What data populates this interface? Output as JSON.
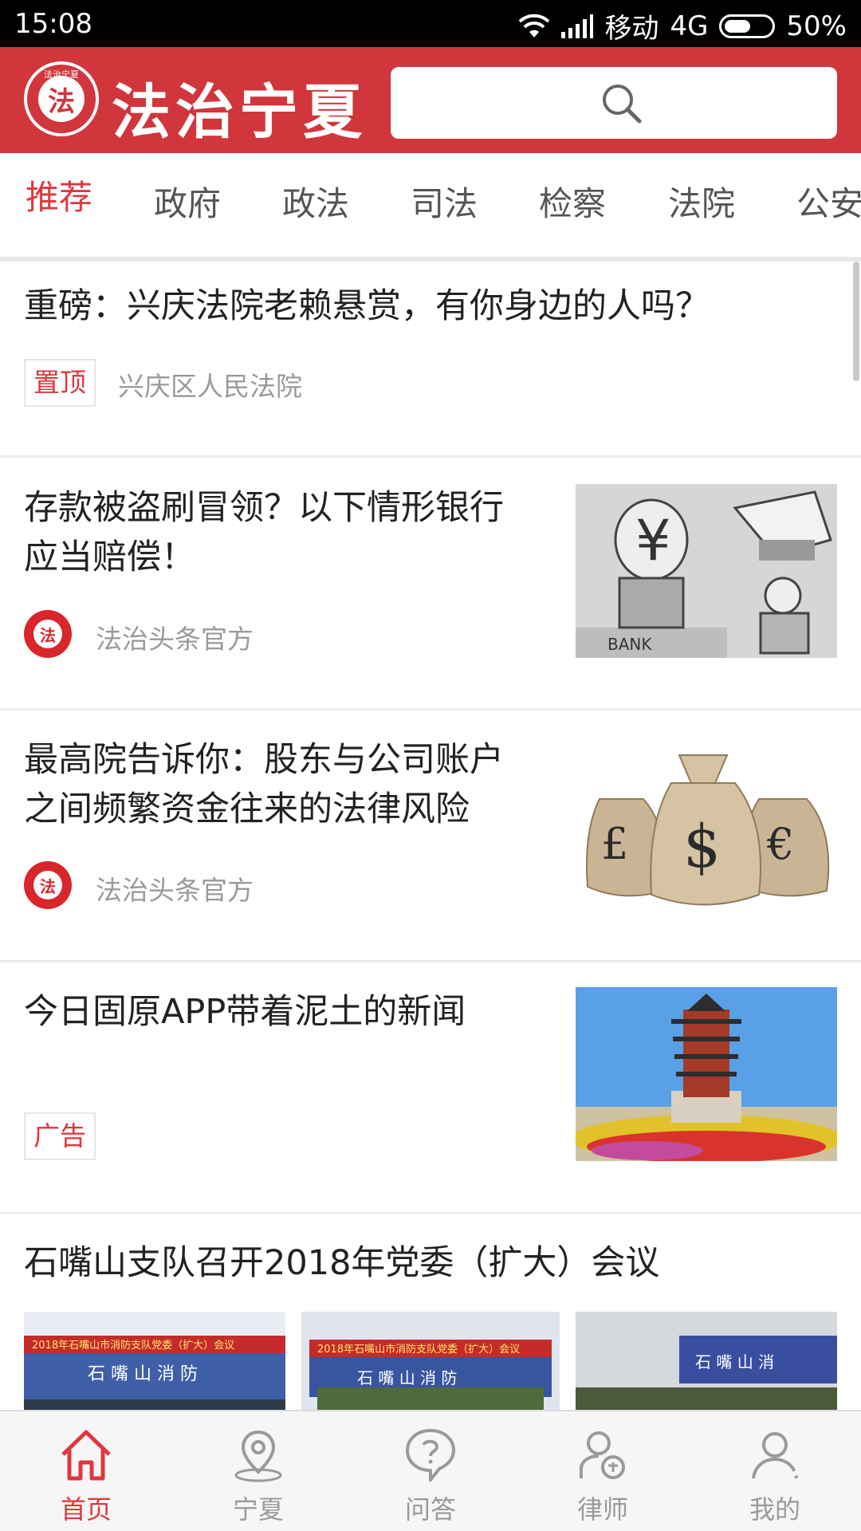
{
  "status_bar": {
    "time": "15:08",
    "carrier": "移动",
    "network": "4G",
    "battery": "50%",
    "battery_level": 0.5
  },
  "header": {
    "brand": "法治宁夏",
    "emblem_char": "法",
    "emblem_ring": "法治宁夏",
    "search_placeholder": ""
  },
  "tabs": [
    "推荐",
    "政府",
    "政法",
    "司法",
    "检察",
    "法院",
    "公安"
  ],
  "active_tab": "推荐",
  "feed": {
    "items": [
      {
        "title": "重磅：兴庆法院老赖悬赏，有你身边的人吗？",
        "tag": "置顶",
        "source": "兴庆区人民法院"
      },
      {
        "title_line1": "存款被盗刷冒领？以下情形银行",
        "title_line2": "应当赔偿！",
        "source": "法治头条官方",
        "avatar_char": "法",
        "image": "cartoon-bank-illustration",
        "image_text_bank": "BANK",
        "image_text_yen": "¥"
      },
      {
        "title_line1": "最高院告诉你：股东与公司账户",
        "title_line2": "之间频繁资金往来的法律风险",
        "source": "法治头条官方",
        "avatar_char": "法",
        "image": "money-bags-photo",
        "bag_symbols": [
          "£",
          "$",
          "€"
        ]
      },
      {
        "title": "今日固原APP带着泥土的新闻",
        "tag": "广告",
        "image": "pagoda-garden-photo"
      },
      {
        "title": "石嘴山支队召开2018年党委（扩大）会议",
        "images": [
          "meeting-photo-1",
          "meeting-photo-2",
          "meeting-photo-3"
        ],
        "banner_text_1": "2018年石嘴山市消防支队党委（扩大）会议",
        "banner_text_2": "2018年石嘴山市消防支队党委（扩大）会议",
        "wall_text_1": "石 嘴 山 消 防",
        "wall_text_2": "石 嘴 山 消 防",
        "wall_text_3": "石  嘴  山  消"
      }
    ]
  },
  "bottom_nav": [
    {
      "label": "首页",
      "icon": "home-icon",
      "active": true
    },
    {
      "label": "宁夏",
      "icon": "location-pin-icon",
      "active": false
    },
    {
      "label": "问答",
      "icon": "question-bubble-icon",
      "active": false
    },
    {
      "label": "律师",
      "icon": "lawyer-icon",
      "active": false
    },
    {
      "label": "我的",
      "icon": "user-icon",
      "active": false
    }
  ],
  "colors": {
    "brand_red": "#d0363c",
    "accent_red": "#e0373d",
    "inactive_gray": "#9a9a9a"
  }
}
